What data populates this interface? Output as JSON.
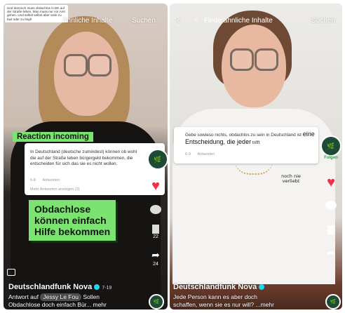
{
  "left": {
    "overlay_note": "Und dennoch muss obdachlos in DE auf der Straße leben. Man muss nur vor Amt gehen. Und selbst selbst aber viele zu faul oder zu feigh",
    "tab_label": "Ähnliche Inhalte",
    "search_label": "Suchen",
    "reaction_tag": "Reaction incoming",
    "comment": {
      "text": "In Deutschland (deutsche zumindest) können ob wohl die auf der Straße leben bürgergeld bekommen, die entscheiden für sich das sie es nicht wollen.",
      "date": "6-8",
      "reply_label": "Antworten",
      "more_replies": "Mehr Antworten anzeigen (2)"
    },
    "sticker": "Obdachlose\nkönnen einfach\nHilfe bekommen",
    "rail": {
      "like_count": "",
      "comment_count": "",
      "save_count": "22",
      "share_count": "24"
    },
    "handle": "Deutschlandfunk Nova",
    "date": "7-19",
    "caption_prefix": "Antwort auf",
    "reply_user": "Jessy Le Fou",
    "caption_rest": "Sollen",
    "caption_line2": "Obdachlose doch einfach Bür... mehr"
  },
  "right": {
    "search_placeholder": "Finde ähnliche Inhalte",
    "search_label": "Suchen",
    "comment": {
      "text_small": "Gebe sowieso nichts, obdachlos zu sein in Deutschland ist",
      "text_big": "eine Entscheidung, die jeder",
      "text_tail": "trifft",
      "date": "6-9",
      "reply_label": "Antworten"
    },
    "note": "noch nie verliebt",
    "handle": "Deutschlandfunk Nova",
    "caption_line1": "Jede Person kann es aber doch",
    "caption_line2": "schaffen, wenn sie es nur will? ...mehr",
    "follow_label": "Folgen"
  },
  "colors": {
    "accent_green": "#7be36f",
    "heart_red": "#f12f4c",
    "avatar_green": "#1e4b35"
  }
}
